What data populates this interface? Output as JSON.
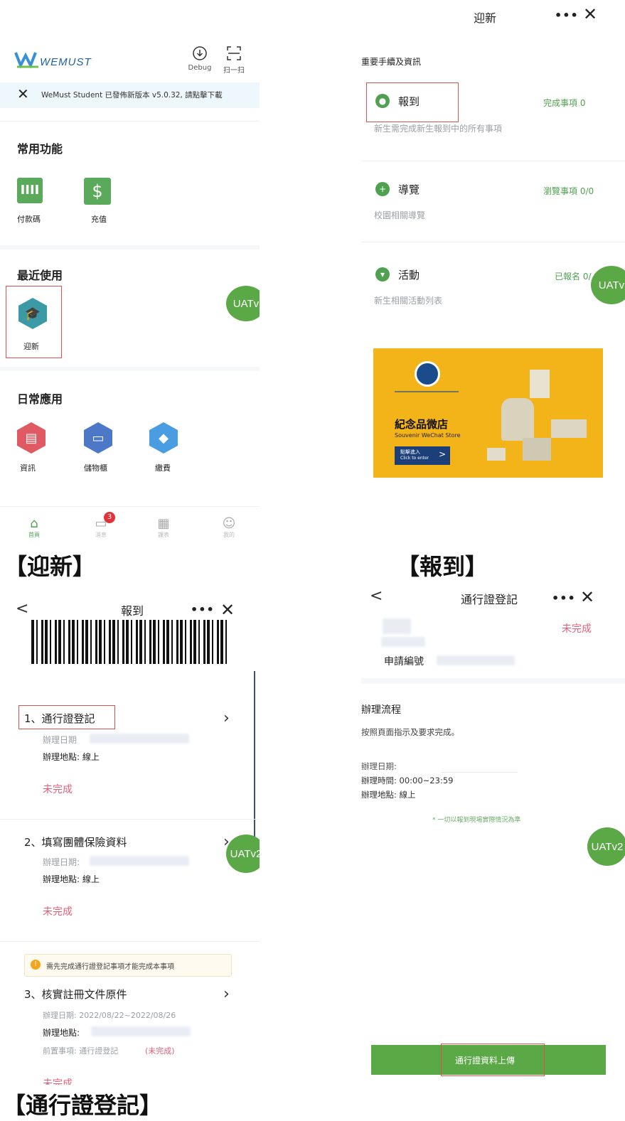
{
  "p1": {
    "logo": "WEMUST",
    "debug_label": "Debug",
    "scan_label": "扫一扫",
    "notice": "WeMust Student 已發佈新版本 v5.0.32, 請點擊下載",
    "common": {
      "title": "常用功能",
      "items": [
        "付款碼",
        "充值"
      ]
    },
    "recent": {
      "title": "最近使用",
      "items": [
        "迎新"
      ]
    },
    "daily": {
      "title": "日常應用",
      "items": [
        "資訊",
        "儲物櫃",
        "繳費"
      ]
    },
    "tabbar": {
      "items": [
        "首頁",
        "消息",
        "課表",
        "我的"
      ],
      "badge": "3"
    },
    "uat": "UATv"
  },
  "p2": {
    "title": "迎新",
    "section_title": "重要手續及資訊",
    "cards": [
      {
        "title": "報到",
        "status": "完成事項 0",
        "desc": "新生需完成新生報到中的所有事項"
      },
      {
        "title": "導覽",
        "status": "瀏覽事項 0/0",
        "desc": "校園相關導覽"
      },
      {
        "title": "活動",
        "status": "已報名 0/",
        "desc": "新生相關活動列表"
      }
    ],
    "banner": {
      "heading": "紀念品微店",
      "sub": "Souvenir WeChat Store",
      "btn": "點擊進入",
      "btn_sub": "Click to enter"
    },
    "uat": "UATv"
  },
  "p3": {
    "title": "報到",
    "items": [
      {
        "title": "1、通行證登記",
        "date_label": "辦理日期",
        "place": "辦理地點: 線上",
        "status": "未完成"
      },
      {
        "title": "2、填寫團體保險資料",
        "date_label": "辦理日期:",
        "place": "辦理地點: 線上",
        "status": "未完成"
      },
      {
        "title": "3、核實註冊文件原件",
        "date_label": "辦理日期: 2022/08/22~2022/08/26",
        "place": "辦理地點:",
        "prereq": "前置事項: 通行證登記",
        "prereq_status": "(未完成)",
        "status": "未完成"
      }
    ],
    "warning": "需先完成通行證登記事項才能完成本事項",
    "uat": "UATv2"
  },
  "p4": {
    "title": "通行證登記",
    "status": "未完成",
    "app_no_label": "申請編號",
    "process_title": "辦理流程",
    "instruction": "按照頁面指示及要求完成。",
    "date_label": "辦理日期:",
    "time": "辦理時間: 00:00~23:59",
    "place": "辦理地點: 線上",
    "note": "* 一切以報到現場實際情況為準",
    "upload_btn": "通行證資料上傳",
    "uat": "UATv2"
  },
  "captions": [
    "【迎新】",
    "【報到】",
    "【通行證登記】"
  ]
}
